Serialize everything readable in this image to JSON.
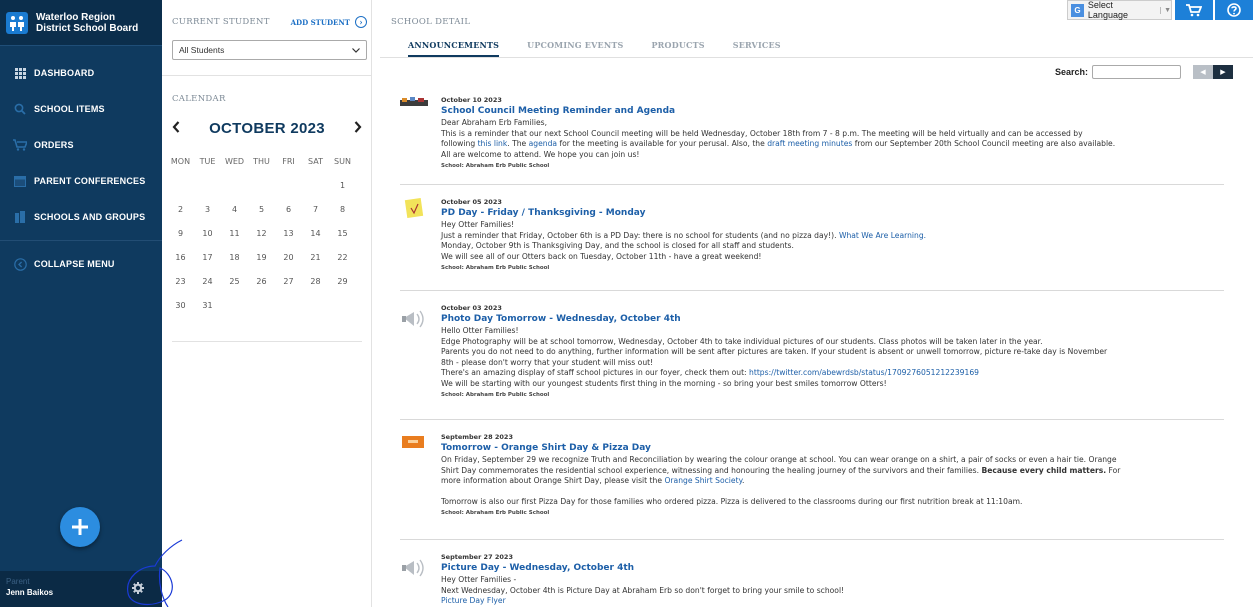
{
  "brand": {
    "line1": "Waterloo Region",
    "line2": "District School Board"
  },
  "nav": {
    "items": [
      {
        "label": "DASHBOARD",
        "icon": "grid-icon"
      },
      {
        "label": "SCHOOL ITEMS",
        "icon": "search-icon"
      },
      {
        "label": "ORDERS",
        "icon": "cart-icon"
      },
      {
        "label": "PARENT CONFERENCES",
        "icon": "calendar-icon"
      },
      {
        "label": "SCHOOLS AND GROUPS",
        "icon": "building-icon"
      }
    ],
    "collapse_label": "COLLAPSE MENU"
  },
  "user": {
    "role": "Parent",
    "name": "Jenn Baikos"
  },
  "student": {
    "section_label": "CURRENT STUDENT",
    "add_label": "ADD STUDENT",
    "selected": "All Students"
  },
  "calendar": {
    "label": "CALENDAR",
    "month": "OCTOBER 2023",
    "dow": [
      "MON",
      "TUE",
      "WED",
      "THU",
      "FRI",
      "SAT",
      "SUN"
    ],
    "days": [
      "",
      "",
      "",
      "",
      "",
      "",
      "1",
      "2",
      "3",
      "4",
      "5",
      "6",
      "7",
      "8",
      "9",
      "10",
      "11",
      "12",
      "13",
      "14",
      "15",
      "16",
      "17",
      "18",
      "19",
      "20",
      "21",
      "22",
      "23",
      "24",
      "25",
      "26",
      "27",
      "28",
      "29",
      "30",
      "31"
    ]
  },
  "top": {
    "language": "Select Language"
  },
  "main": {
    "section_label": "SCHOOL DETAIL",
    "tabs": [
      "ANNOUNCEMENTS",
      "UPCOMING EVENTS",
      "PRODUCTS",
      "SERVICES"
    ],
    "search_label": "Search:"
  },
  "announcements": [
    {
      "date": "October 10 2023",
      "title": "School Council Meeting Reminder and Agenda",
      "l1": "Dear Abraham Erb Families,",
      "l2": "This is a reminder that our next School Council meeting will be held Wednesday, October 18th from 7 - 8 p.m.  The meeting will be held virtually and can be accessed by",
      "l3a": "following ",
      "l3link1": "this link",
      "l3b": ".  The ",
      "l3link2": "agenda",
      "l3c": " for the meeting is available for your perusal.  Also, the ",
      "l3link3": "draft meeting minutes",
      "l3d": " from our September 20th School Council meeting are also available.",
      "l4": "All are welcome to attend.  We hope you can join us!",
      "school": "School: Abraham Erb Public School"
    },
    {
      "date": "October 05 2023",
      "title": "PD Day - Friday / Thanksgiving - Monday",
      "l1": "Hey Otter Families!",
      "l2a": "Just a reminder that Friday, October 6th is a PD Day: there is no school for students (and no pizza day!).  ",
      "l2link": "What We Are Learning.",
      "l3": "Monday, October 9th is Thanksgiving Day, and the school is closed for all staff and students.",
      "l4": "We will see all of our Otters back on Tuesday, October 11th - have a great weekend!",
      "school": "School: Abraham Erb Public School"
    },
    {
      "date": "October 03 2023",
      "title": "Photo Day Tomorrow - Wednesday, October 4th",
      "l1": "Hello Otter Families!",
      "l2": "Edge Photography will be at school tomorrow, Wednesday, October 4th to take individual pictures of our students. Class photos will be taken later in the year.",
      "l3": "Parents you do not need to do anything, further information will be sent after pictures are taken. If your student is absent or unwell tomorrow, picture re-take day is November",
      "l4": "8th - please don't worry that your student will miss out!",
      "l5a": "There's an amazing display of staff school pictures in our foyer, check them out: ",
      "l5link": "https://twitter.com/abewrdsb/status/1709276051212239169",
      "l6": "We will be starting with our youngest students first thing in the morning - so bring your best smiles tomorrow Otters!",
      "school": "School: Abraham Erb Public School"
    },
    {
      "date": "September 28 2023",
      "title": "Tomorrow - Orange Shirt Day & Pizza Day",
      "l1": "On Friday, September 29 we recognize Truth and Reconciliation by wearing the colour orange at school.  You can wear orange on a shirt, a pair of socks or even a hair tie.  Orange",
      "l2a": "Shirt Day commemorates the residential school experience, witnessing and honouring the healing journey of the survivors and their families. ",
      "l2bold": "Because every child matters.",
      "l2b": " For",
      "l3a": "more information about Orange Shirt Day, please visit the ",
      "l3link": "Orange Shirt Society",
      "l3b": ".",
      "l4": "Tomorrow is also our first Pizza Day for those families who ordered pizza.  Pizza is delivered to the classrooms during our first nutrition break at 11:10am.",
      "school": "School: Abraham Erb Public School"
    },
    {
      "date": "September 27 2023",
      "title": "Picture Day - Wednesday, October 4th",
      "l1": "Hey Otter Families -",
      "l2": "Next Wednesday, October 4th is Picture Day at Abraham Erb so don't forget to bring your smile to school!",
      "l3link": "Picture Day Flyer"
    }
  ]
}
